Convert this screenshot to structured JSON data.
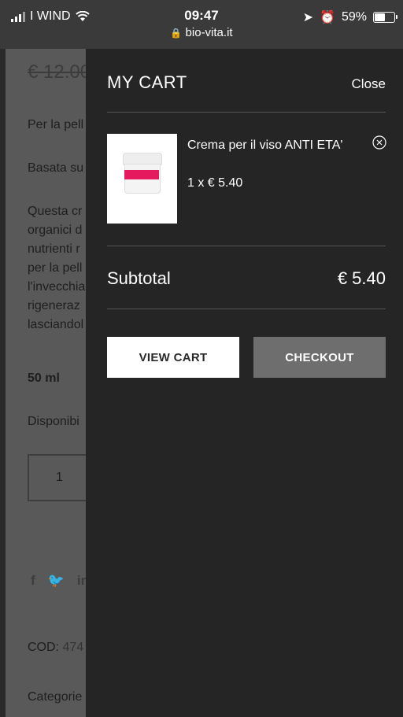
{
  "status_bar": {
    "carrier": "I WIND",
    "time": "09:47",
    "url": "bio-vita.it",
    "battery": "59%",
    "battery_level": 0.59
  },
  "background_page": {
    "price": "€ 12.00",
    "lines": [
      "Per la pell",
      "Basata su",
      "Questa cr",
      "organici d",
      "nutrienti r",
      "per la pell",
      "l'invecchia",
      "rigeneraz",
      "lasciandol"
    ],
    "size": "50 ml",
    "availability": "Disponibi",
    "quantity": "1",
    "social_icons": [
      "facebook-icon",
      "twitter-icon",
      "linkedin-icon"
    ],
    "cod_label": "COD:",
    "cod_value": "474",
    "categories": "Categorie"
  },
  "cart": {
    "title": "MY CART",
    "close_label": "Close",
    "items": [
      {
        "name": "Crema per il viso ANTI ETA'",
        "quantity_price": "1 x € 5.40",
        "image_icon": "cream-jar-image"
      }
    ],
    "subtotal_label": "Subtotal",
    "subtotal_value": "€ 5.40",
    "view_cart_label": "VIEW CART",
    "checkout_label": "CHECKOUT"
  }
}
